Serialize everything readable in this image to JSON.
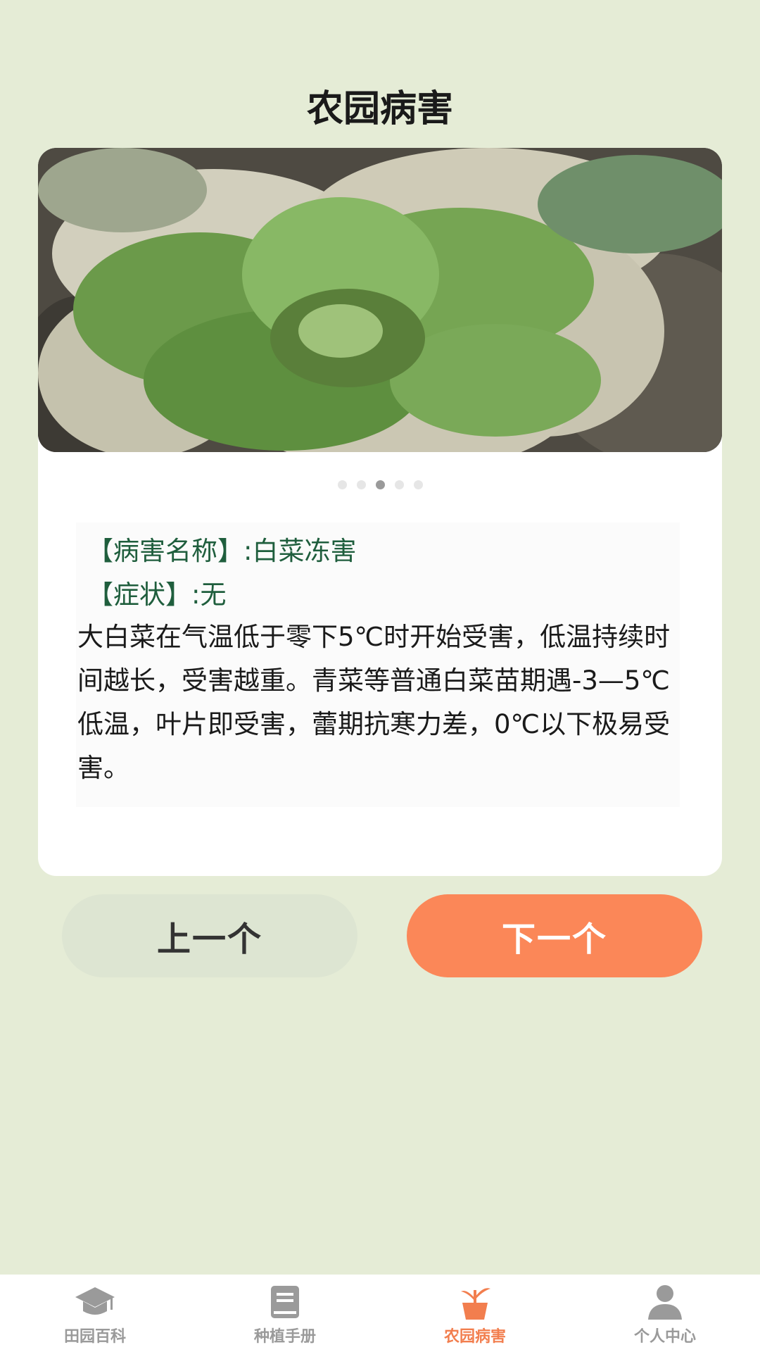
{
  "header": {
    "title": "农园病害"
  },
  "carousel": {
    "total": 5,
    "active_index": 2
  },
  "disease": {
    "name_label": "【病害名称】:白菜冻害",
    "symptom_label": "【症状】:无",
    "description": "大白菜在气温低于零下5℃时开始受害，低温持续时间越长，受害越重。青菜等普通白菜苗期遇-3—5℃低温，叶片即受害，蕾期抗寒力差，0℃以下极易受害。"
  },
  "buttons": {
    "prev_label": "上一个",
    "next_label": "下一个"
  },
  "tabbar": {
    "items": [
      {
        "label": "田园百科",
        "icon": "graduation-cap-icon"
      },
      {
        "label": "种植手册",
        "icon": "book-icon"
      },
      {
        "label": "农园病害",
        "icon": "plant-pot-icon"
      },
      {
        "label": "个人中心",
        "icon": "person-icon"
      }
    ],
    "active_index": 2,
    "active_color": "#f27e4e",
    "inactive_color": "#9a9a9a"
  },
  "colors": {
    "background": "#e5ecd6",
    "accent": "#fb8758",
    "label_green": "#1f5e3d"
  }
}
